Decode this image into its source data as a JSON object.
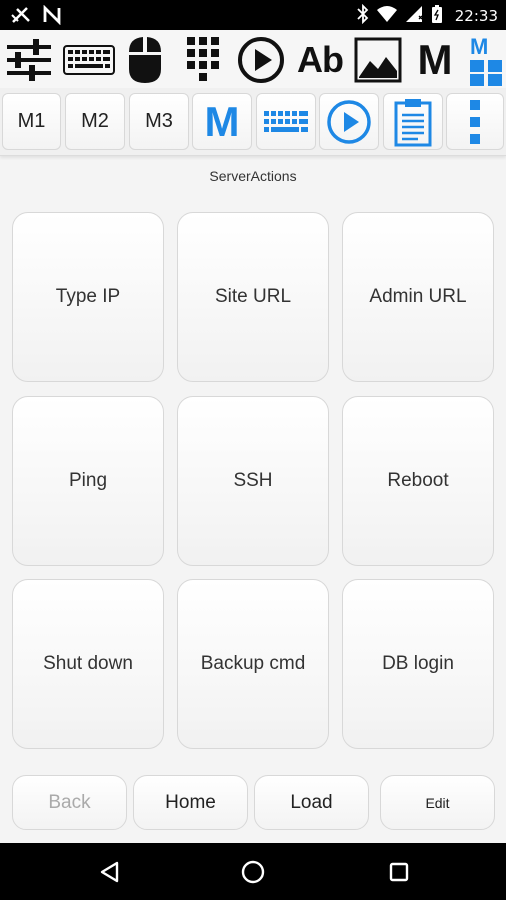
{
  "status_bar": {
    "time": "22:33",
    "icons": [
      "no-sim-icon",
      "n-notification-icon",
      "bluetooth-icon",
      "wifi-icon",
      "signal-icon",
      "battery-icon"
    ]
  },
  "toolbar_top": {
    "icons": [
      "mixer-sliders-icon",
      "keyboard-icon",
      "mouse-icon",
      "numpad-icon",
      "play-circle-icon",
      "text-icon",
      "image-icon",
      "macro-icon",
      "macro-grid-icon"
    ],
    "text_label": "Ab",
    "macro_label": "M",
    "macro_grid_label": "M"
  },
  "toolbar_second": {
    "m1": "M1",
    "m2": "M2",
    "m3": "M3",
    "macro_label": "M",
    "accent": "#1e88e5"
  },
  "page": {
    "title": "ServerActions"
  },
  "actions": [
    {
      "label": "Type IP"
    },
    {
      "label": "Site URL"
    },
    {
      "label": "Admin URL"
    },
    {
      "label": "Ping"
    },
    {
      "label": "SSH"
    },
    {
      "label": "Reboot"
    },
    {
      "label": "Shut down"
    },
    {
      "label": "Backup cmd"
    },
    {
      "label": "DB login"
    }
  ],
  "bottom": {
    "back": "Back",
    "home": "Home",
    "load": "Load",
    "edit": "Edit"
  },
  "nav": {
    "icons": [
      "back-triangle-icon",
      "home-circle-icon",
      "recents-square-icon"
    ]
  }
}
